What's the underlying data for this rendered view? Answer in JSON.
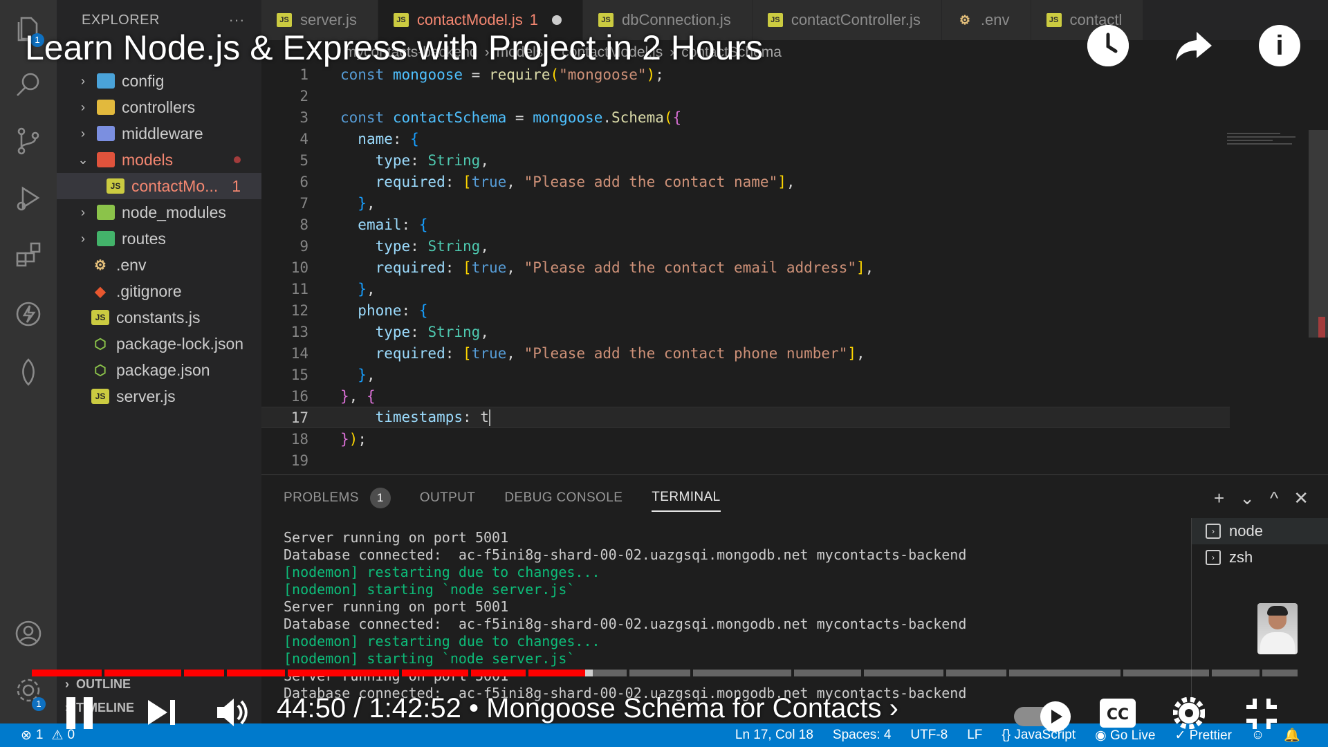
{
  "explorer": {
    "title": "EXPLORER",
    "more": "···",
    "tree": [
      {
        "name": "config",
        "type": "folder",
        "color": "#4aa3d9",
        "expanded": false
      },
      {
        "name": "controllers",
        "type": "folder",
        "color": "#e2b93d",
        "expanded": false
      },
      {
        "name": "middleware",
        "type": "folder",
        "color": "#7b8fe0",
        "expanded": false
      },
      {
        "name": "models",
        "type": "folder",
        "color": "#e0533c",
        "expanded": true
      },
      {
        "name": "contactMo...",
        "type": "js",
        "color": "#cbcb41",
        "count": "1"
      },
      {
        "name": "node_modules",
        "type": "folder",
        "color": "#8bc34a",
        "expanded": false
      },
      {
        "name": "routes",
        "type": "folder",
        "color": "#43b36a",
        "expanded": false
      },
      {
        "name": ".env",
        "type": "env",
        "color": "#e5c07b"
      },
      {
        "name": ".gitignore",
        "type": "git",
        "color": "#e8572f"
      },
      {
        "name": "constants.js",
        "type": "js",
        "color": "#cbcb41"
      },
      {
        "name": "package-lock.json",
        "type": "json",
        "color": "#8bc34a"
      },
      {
        "name": "package.json",
        "type": "json",
        "color": "#8bc34a"
      },
      {
        "name": "server.js",
        "type": "js",
        "color": "#cbcb41"
      }
    ],
    "outline": "OUTLINE",
    "timeline": "TIMELINE"
  },
  "tabs": [
    {
      "label": "server.js",
      "active": false
    },
    {
      "label": "contactModel.js",
      "active": true,
      "count": "1",
      "dirty": true
    },
    {
      "label": "dbConnection.js",
      "active": false
    },
    {
      "label": "contactController.js",
      "active": false
    },
    {
      "label": ".env",
      "active": false
    },
    {
      "label": "contactl",
      "active": false
    }
  ],
  "breadcrumb": [
    "mycontacts-backend",
    "models",
    "contactModel.js",
    "contactSchema"
  ],
  "editor": {
    "lines": [
      {
        "n": "1",
        "html": "<span class='kw'>const</span> <span class='var'>mongoose</span> = <span class='fn'>require</span><span class='br1'>(</span><span class='str'>\"mongoose\"</span><span class='br1'>)</span>;"
      },
      {
        "n": "2",
        "html": ""
      },
      {
        "n": "3",
        "html": "<span class='kw'>const</span> <span class='var'>contactSchema</span> = <span class='var'>mongoose</span>.<span class='fn'>Schema</span><span class='br1'>(</span><span class='br2'>{</span>"
      },
      {
        "n": "4",
        "html": "  <span class='prop'>name</span>: <span class='br3'>{</span>"
      },
      {
        "n": "5",
        "html": "    <span class='prop'>type</span>: <span class='cls'>String</span>,"
      },
      {
        "n": "6",
        "html": "    <span class='prop'>required</span>: <span class='br1'>[</span><span class='bool'>true</span>, <span class='str'>\"Please add the contact name\"</span><span class='br1'>]</span>,"
      },
      {
        "n": "7",
        "html": "  <span class='br3'>}</span>,"
      },
      {
        "n": "8",
        "html": "  <span class='prop'>email</span>: <span class='br3'>{</span>"
      },
      {
        "n": "9",
        "html": "    <span class='prop'>type</span>: <span class='cls'>String</span>,"
      },
      {
        "n": "10",
        "html": "    <span class='prop'>required</span>: <span class='br1'>[</span><span class='bool'>true</span>, <span class='str'>\"Please add the contact email address\"</span><span class='br1'>]</span>,"
      },
      {
        "n": "11",
        "html": "  <span class='br3'>}</span>,"
      },
      {
        "n": "12",
        "html": "  <span class='prop'>phone</span>: <span class='br3'>{</span>"
      },
      {
        "n": "13",
        "html": "    <span class='prop'>type</span>: <span class='cls'>String</span>,"
      },
      {
        "n": "14",
        "html": "    <span class='prop'>required</span>: <span class='br1'>[</span><span class='bool'>true</span>, <span class='str'>\"Please add the contact phone number\"</span><span class='br1'>]</span>,"
      },
      {
        "n": "15",
        "html": "  <span class='br3'>}</span>,"
      },
      {
        "n": "16",
        "html": "<span class='br2'>}</span>, <span class='br2'>{</span>"
      },
      {
        "n": "17",
        "html": "    <span class='prop'>timestamps</span>: t<span class='cursor'></span>",
        "current": true
      },
      {
        "n": "18",
        "html": "<span class='br2'>}</span><span class='br1'>)</span>;"
      },
      {
        "n": "19",
        "html": ""
      }
    ]
  },
  "panel": {
    "tabs": [
      {
        "label": "PROBLEMS",
        "badge": "1"
      },
      {
        "label": "OUTPUT"
      },
      {
        "label": "DEBUG CONSOLE"
      },
      {
        "label": "TERMINAL",
        "active": true
      }
    ],
    "actions": [
      "+",
      "⌄",
      "^",
      "✕"
    ],
    "terminal_lines": [
      {
        "text": "Server running on port 5001",
        "kind": "normal"
      },
      {
        "text": "Database connected:  ac-f5ini8g-shard-00-02.uazgsqi.mongodb.net mycontacts-backend",
        "kind": "normal"
      },
      {
        "text": "[nodemon] restarting due to changes...",
        "kind": "green"
      },
      {
        "text": "[nodemon] starting `node server.js`",
        "kind": "green"
      },
      {
        "text": "Server running on port 5001",
        "kind": "normal"
      },
      {
        "text": "Database connected:  ac-f5ini8g-shard-00-02.uazgsqi.mongodb.net mycontacts-backend",
        "kind": "normal"
      },
      {
        "text": "[nodemon] restarting due to changes...",
        "kind": "green"
      },
      {
        "text": "[nodemon] starting `node server.js`",
        "kind": "green"
      },
      {
        "text": "Server running on port 5001",
        "kind": "normal"
      },
      {
        "text": "Database connected:  ac-f5ini8g-shard-00-02.uazgsqi.mongodb.net mycontacts-backend",
        "kind": "normal"
      }
    ],
    "terminal_list": [
      "node",
      "zsh"
    ]
  },
  "statusbar": {
    "errors": "1",
    "warnings": "0",
    "position": "Ln 17, Col 18",
    "spaces": "Spaces: 4",
    "encoding": "UTF-8",
    "eol": "LF",
    "language": "JavaScript",
    "golive": "Go Live",
    "prettier": "Prettier"
  },
  "video": {
    "title": "Learn Node.js & Express with Project in 2 Hours",
    "time": "44:50 / 1:42:52 • Mongoose Schema for Contacts ›",
    "progress": 0.437,
    "buffered": 0.443,
    "accent": "#ff0000"
  },
  "activity_badges": {
    "explorer": "1",
    "settings": "1"
  }
}
